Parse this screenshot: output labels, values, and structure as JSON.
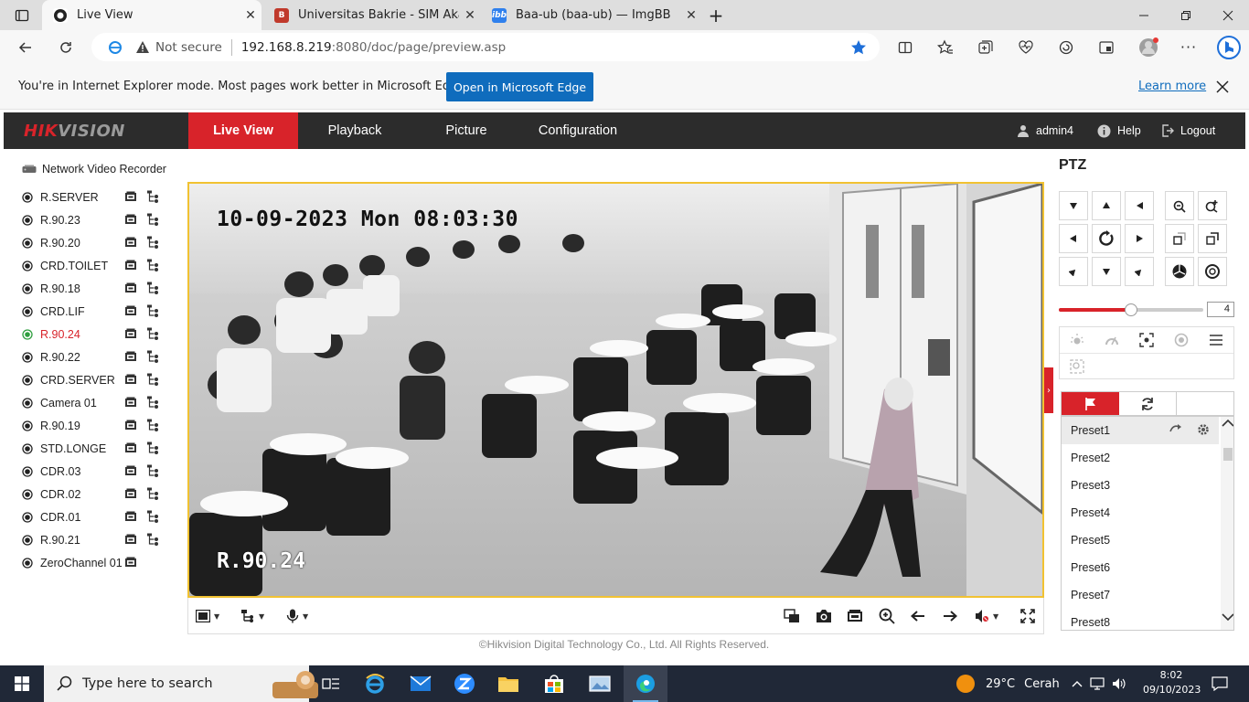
{
  "browser": {
    "tabs": [
      {
        "title": "Live View",
        "active": true
      },
      {
        "title": "Universitas Bakrie - SIM Akademik",
        "active": false
      },
      {
        "title": "Baa-ub (baa-ub) — ImgBB",
        "active": false
      }
    ],
    "address": {
      "security": "Not secure",
      "host": "192.168.8.219",
      "rest": ":8080/doc/page/preview.asp"
    },
    "ie_bar": {
      "message": "You're in Internet Explorer mode. Most pages work better in Microsoft Edge.",
      "button": "Open in Microsoft Edge",
      "link": "Learn more"
    }
  },
  "nvr": {
    "logo_red": "HIK",
    "logo_grey": "VISION",
    "nav": [
      {
        "label": "Live View",
        "active": true
      },
      {
        "label": "Playback",
        "active": false
      },
      {
        "label": "Picture",
        "active": false
      },
      {
        "label": "Configuration",
        "active": false
      }
    ],
    "user": "admin4",
    "help": "Help",
    "logout": "Logout",
    "tree_root": "Network Video Recorder",
    "cameras": [
      {
        "name": "R.SERVER"
      },
      {
        "name": "R.90.23"
      },
      {
        "name": "R.90.20"
      },
      {
        "name": "CRD.TOILET"
      },
      {
        "name": "R.90.18"
      },
      {
        "name": "CRD.LIF"
      },
      {
        "name": "R.90.24",
        "active": true
      },
      {
        "name": "R.90.22"
      },
      {
        "name": "CRD.SERVER"
      },
      {
        "name": "Camera 01"
      },
      {
        "name": "R.90.19"
      },
      {
        "name": "STD.LONGE"
      },
      {
        "name": "CDR.03"
      },
      {
        "name": "CDR.02"
      },
      {
        "name": "CDR.01"
      },
      {
        "name": "R.90.21"
      },
      {
        "name": "ZeroChannel 01"
      }
    ],
    "video": {
      "osd_time": "10-09-2023 Mon 08:03:30",
      "osd_camera": "R.90.24"
    },
    "copyright": "©Hikvision Digital Technology Co., Ltd. All Rights Reserved.",
    "ptz": {
      "title": "PTZ",
      "speed": "4",
      "speed_fraction": 0.5,
      "presets": [
        "Preset1",
        "Preset2",
        "Preset3",
        "Preset4",
        "Preset5",
        "Preset6",
        "Preset7",
        "Preset8"
      ]
    },
    "accent": "#d8232a"
  },
  "taskbar": {
    "search_placeholder": "Type here to search",
    "weather_temp": "29°C",
    "weather_desc": "Cerah",
    "time": "8:02",
    "date": "09/10/2023"
  }
}
